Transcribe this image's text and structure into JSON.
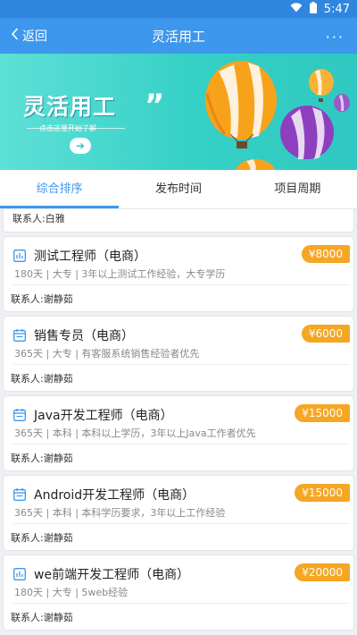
{
  "status": {
    "time": "5:47"
  },
  "nav": {
    "back_label": "返回",
    "title": "灵活用工",
    "more": "···"
  },
  "banner": {
    "headline": "灵活用工",
    "quote": "”",
    "subtitle": "点击这里开始了解",
    "arrow": "➜"
  },
  "tabs": [
    {
      "label": "综合排序",
      "active": true
    },
    {
      "label": "发布时间",
      "active": false
    },
    {
      "label": "项目周期",
      "active": false
    }
  ],
  "partial_contact": "联系人:白雅",
  "jobs": [
    {
      "title": "测试工程师（电商）",
      "salary": "¥8000",
      "meta": "180天 | 大专 | 3年以上测试工作经验，大专学历",
      "contact": "联系人:谢静茹",
      "icon": "chart-doc-icon"
    },
    {
      "title": "销售专员（电商）",
      "salary": "¥6000",
      "meta": "365天 | 大专 | 有客服系统销售经验者优先",
      "contact": "联系人:谢静茹",
      "icon": "calendar-doc-icon"
    },
    {
      "title": "Java开发工程师（电商）",
      "salary": "¥15000",
      "meta": "365天 | 本科 | 本科以上学历，3年以上Java工作者优先",
      "contact": "联系人:谢静茹",
      "icon": "calendar-doc-icon"
    },
    {
      "title": "Android开发工程师（电商）",
      "salary": "¥15000",
      "meta": "365天 | 本科 | 本科学历要求，3年以上工作经验",
      "contact": "联系人:谢静茹",
      "icon": "calendar-doc-icon"
    },
    {
      "title": "we前端开发工程师（电商）",
      "salary": "¥20000",
      "meta": "180天 | 大专 | 5web经验",
      "contact": "联系人:谢静茹",
      "icon": "chart-doc-icon"
    }
  ],
  "colors": {
    "primary": "#3d97ec",
    "salary_badge": "#f5a623",
    "banner_teal": "#35d0c6"
  }
}
